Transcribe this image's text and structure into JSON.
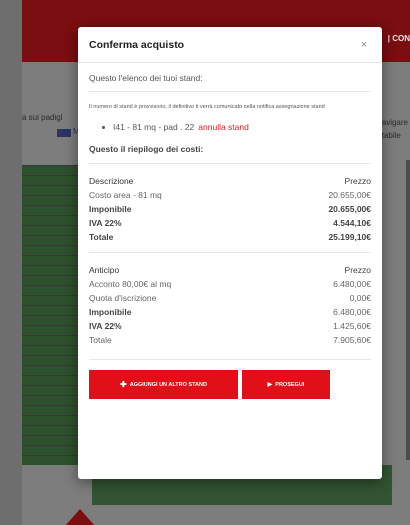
{
  "background": {
    "topbar_text": "| CON",
    "left_text": "a sui padigl",
    "flag_label": "M",
    "right_text_1": "avigare",
    "right_text_2": "tabile"
  },
  "modal": {
    "title": "Conferma acquisto",
    "close_glyph": "×",
    "intro": "Questo l'elenco dei tuoi stand:",
    "note": "Il numero di stand è provvisorio, il definitivo ti verrà comunicato nella notifica assegnazione stand",
    "stand": {
      "label": "I41 - 81 mq - pad . 22",
      "cancel_label": "annulla stand"
    },
    "recap_title": "Questo il riepilogo dei costi:",
    "costs": {
      "header": {
        "left": "Descrizione",
        "right": "Prezzo"
      },
      "rows": [
        {
          "left": "Costo area - 81 mq",
          "right": "20.655,00€"
        },
        {
          "left": "Imponibile",
          "right": "20.655,00€"
        },
        {
          "left": "IVA 22%",
          "right": "4.544,10€"
        },
        {
          "left": "Totale",
          "right": "25.199,10€"
        }
      ]
    },
    "advance": {
      "header": {
        "left": "Anticipo",
        "right": "Prezzo"
      },
      "rows": [
        {
          "left": "Acconto 80,00€ al mq",
          "right": "6.480,00€"
        },
        {
          "left": "Quota d'iscrizione",
          "right": "0,00€"
        },
        {
          "left": "Imponibile",
          "right": "6.480,00€"
        },
        {
          "left": "IVA 22%",
          "right": "1.425,60€"
        },
        {
          "left": "Totale",
          "right": "7.905,60€"
        }
      ]
    },
    "buttons": {
      "add_label": "AGGIUNGI UN ALTRO STAND",
      "next_label": "PROSEGUI"
    }
  },
  "colors": {
    "accent": "#e10f17",
    "link": "#d61d24"
  }
}
